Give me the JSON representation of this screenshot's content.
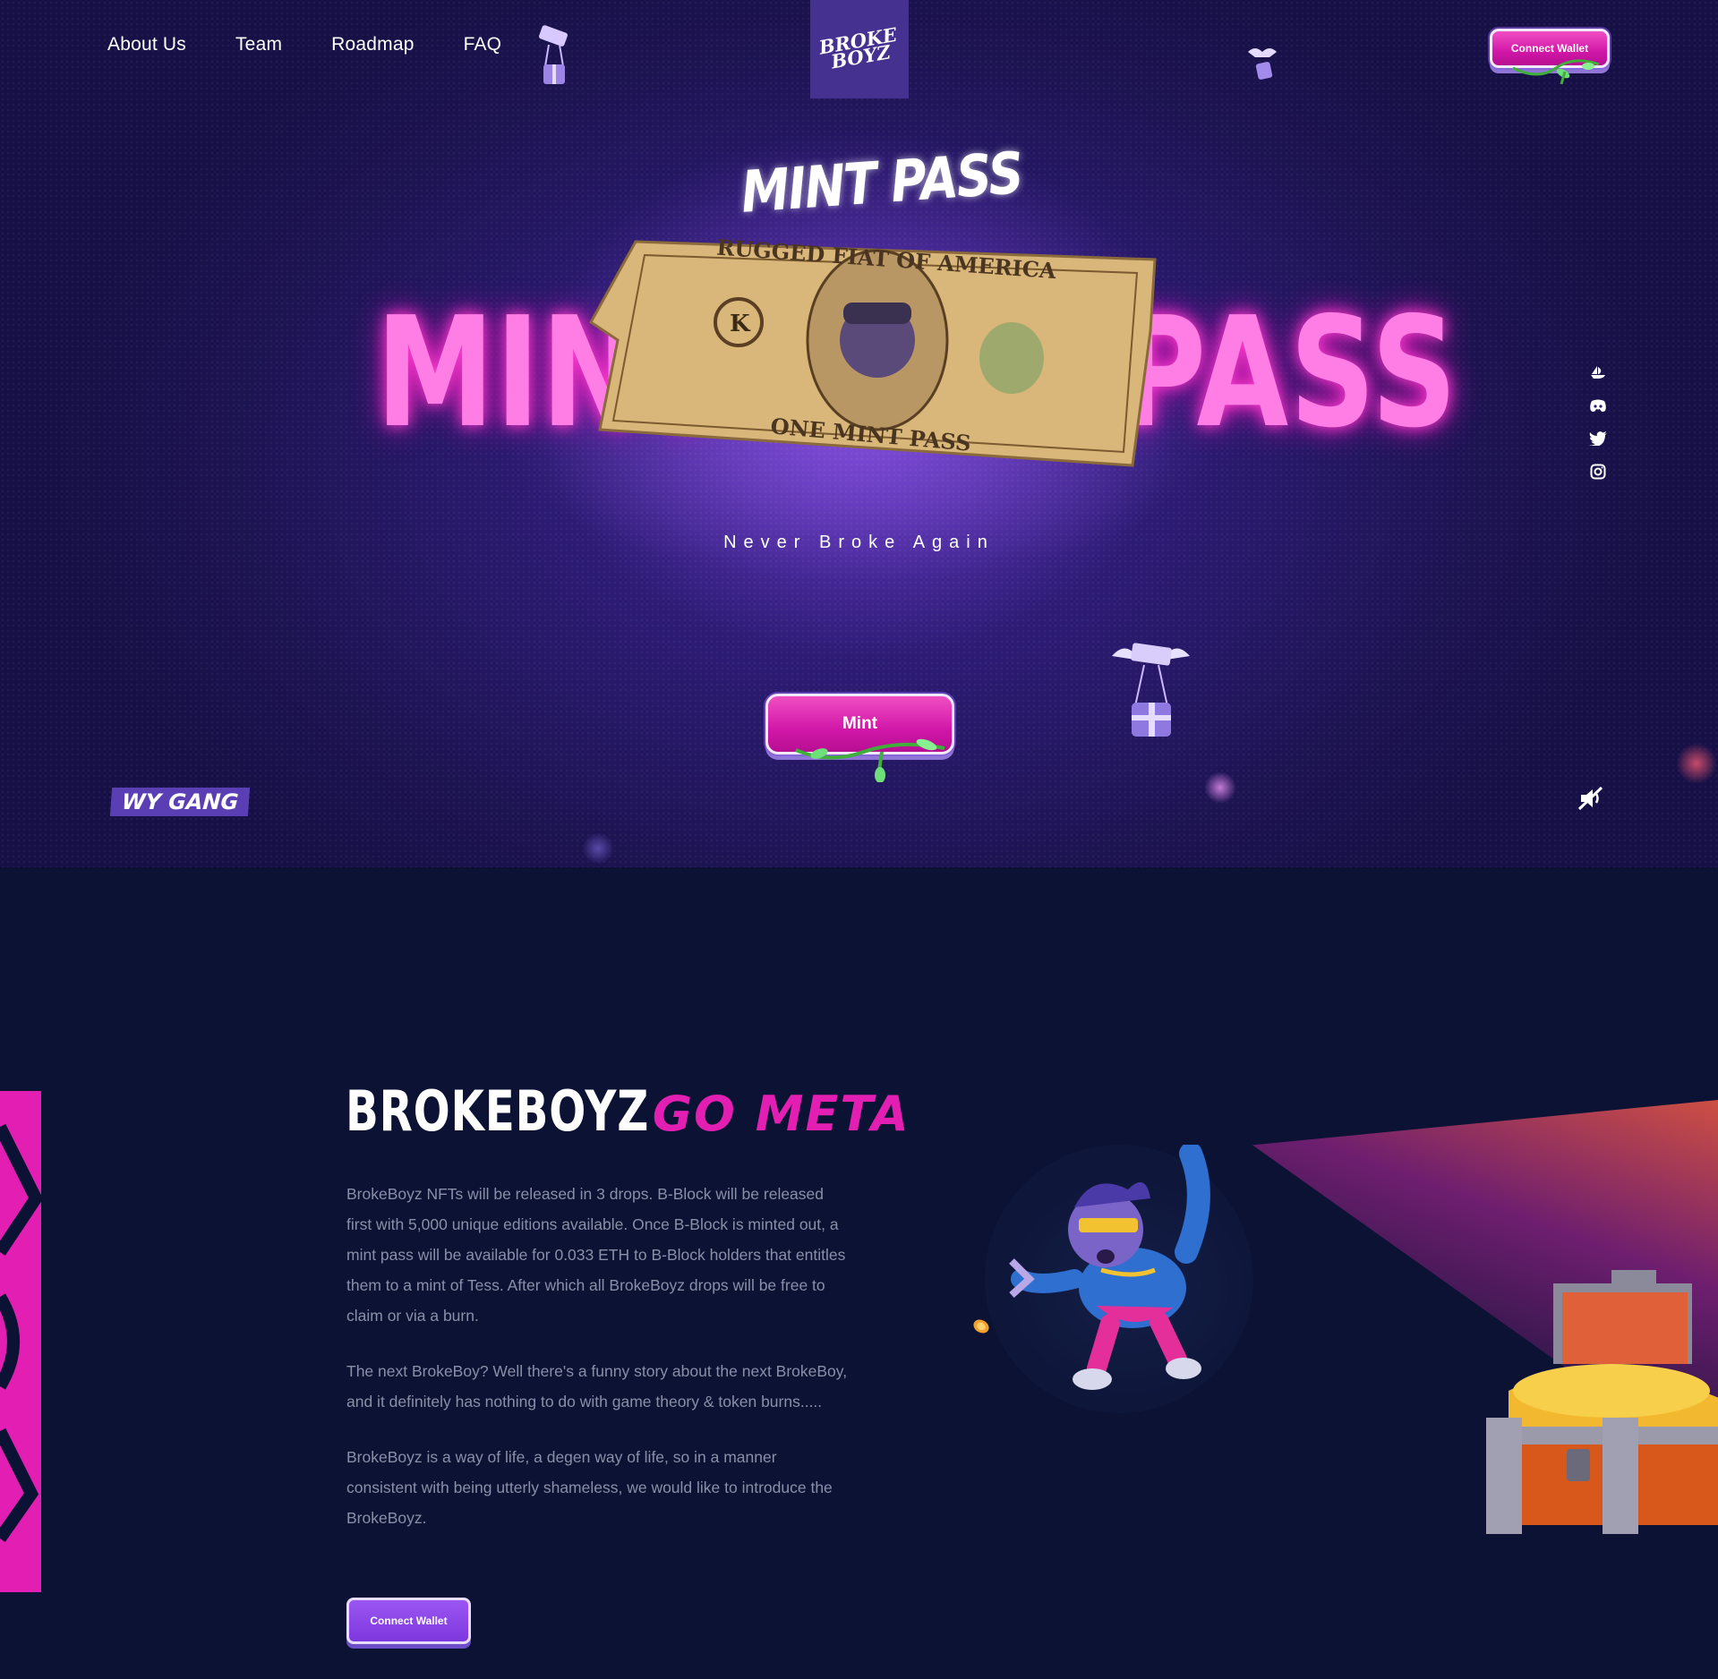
{
  "nav": {
    "items": [
      "About Us",
      "Team",
      "Roadmap",
      "FAQ"
    ]
  },
  "logo": {
    "text": "BROKE BOYZ"
  },
  "header": {
    "connect_label": "Connect Wallet"
  },
  "hero": {
    "script_title": "MINT PASS",
    "title_left": "MINT",
    "title_right": "PASS",
    "bill_text": "RUGGED FIAT OF AMERICA",
    "bill_bottom": "ONE MINT PASS",
    "tagline": "Never Broke Again",
    "mint_label": "Mint",
    "gang_label": "WY GANG"
  },
  "socials": [
    "opensea-icon",
    "discord-icon",
    "twitter-icon",
    "instagram-icon"
  ],
  "about": {
    "title_white": "BROKEBOYZ",
    "title_pink": "GO META",
    "paragraphs": [
      "BrokeBoyz NFTs will be released in 3 drops. B-Block will be released first with 5,000 unique editions available. Once B-Block is minted out, a mint pass will be available for 0.033 ETH to B-Block holders that entitles them to a mint of Tess. After which all BrokeBoyz drops will be free to claim or via a burn.",
      "The next BrokeBoy? Well there's a funny story about the next BrokeBoy, and it definitely has nothing to do with game theory & token burns.....",
      "BrokeBoyz is a way of life, a degen way of life, so in a manner consistent with being utterly shameless, we would like to introduce the BrokeBoyz."
    ],
    "connect_label": "Connect Wallet"
  },
  "colors": {
    "accent_pink": "#e21fb2",
    "accent_purple": "#7d37de",
    "hero_bg": "#2a1a6e",
    "about_bg": "#0b1233"
  }
}
